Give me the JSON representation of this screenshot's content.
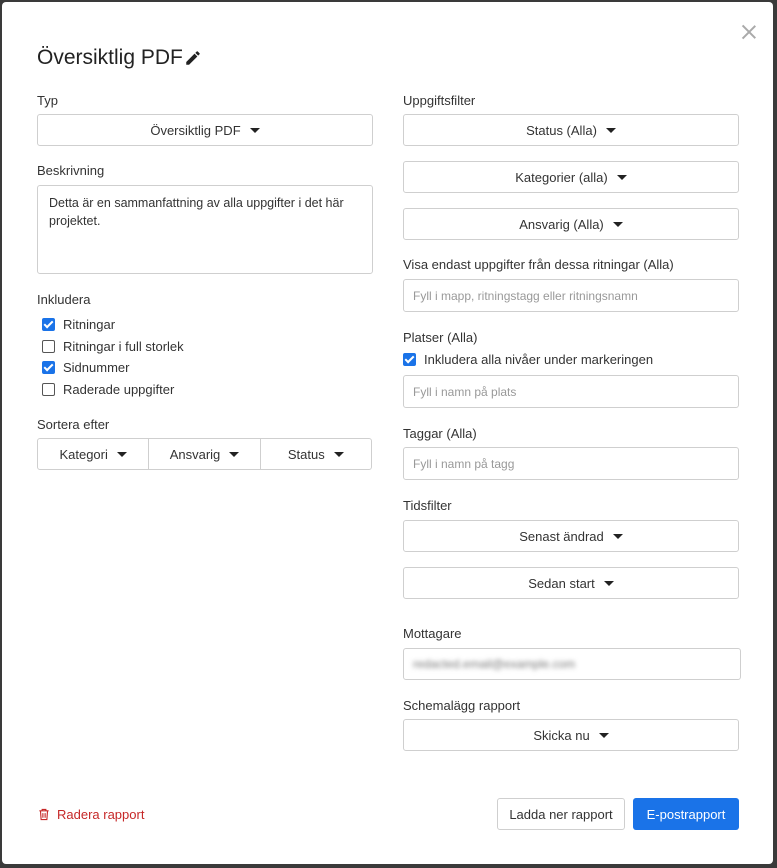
{
  "title": "Översiktlig PDF",
  "left": {
    "type_label": "Typ",
    "type_value": "Översiktlig PDF",
    "description_label": "Beskrivning",
    "description_value": "Detta är en sammanfattning av alla uppgifter i det här projektet.",
    "include_label": "Inkludera",
    "include_options": [
      {
        "label": "Ritningar",
        "checked": true
      },
      {
        "label": "Ritningar i full storlek",
        "checked": false
      },
      {
        "label": "Sidnummer",
        "checked": true
      },
      {
        "label": "Raderade uppgifter",
        "checked": false
      }
    ],
    "sort_label": "Sortera efter",
    "sort_options": [
      "Kategori",
      "Ansvarig",
      "Status"
    ]
  },
  "right": {
    "task_filter_label": "Uppgiftsfilter",
    "status": "Status (Alla)",
    "categories": "Kategorier (alla)",
    "assignee": "Ansvarig (Alla)",
    "drawings_label": "Visa endast uppgifter från dessa ritningar (Alla)",
    "drawings_placeholder": "Fyll i mapp, ritningstagg eller ritningsnamn",
    "locations_label": "Platser (Alla)",
    "include_levels_label": "Inkludera alla nivåer under markeringen",
    "include_levels_checked": true,
    "location_placeholder": "Fyll i namn på plats",
    "tags_label": "Taggar (Alla)",
    "tags_placeholder": "Fyll i namn på tagg",
    "time_filter_label": "Tidsfilter",
    "time_last_changed": "Senast ändrad",
    "time_since": "Sedan start",
    "recipients_label": "Mottagare",
    "recipient_value": "redacted.email@example.com",
    "schedule_label": "Schemalägg rapport",
    "schedule_value": "Skicka nu"
  },
  "footer": {
    "delete_label": "Radera rapport",
    "download_label": "Ladda ner rapport",
    "email_label": "E-postrapport"
  },
  "colors": {
    "accent": "#1a73e8",
    "danger": "#c62828"
  }
}
